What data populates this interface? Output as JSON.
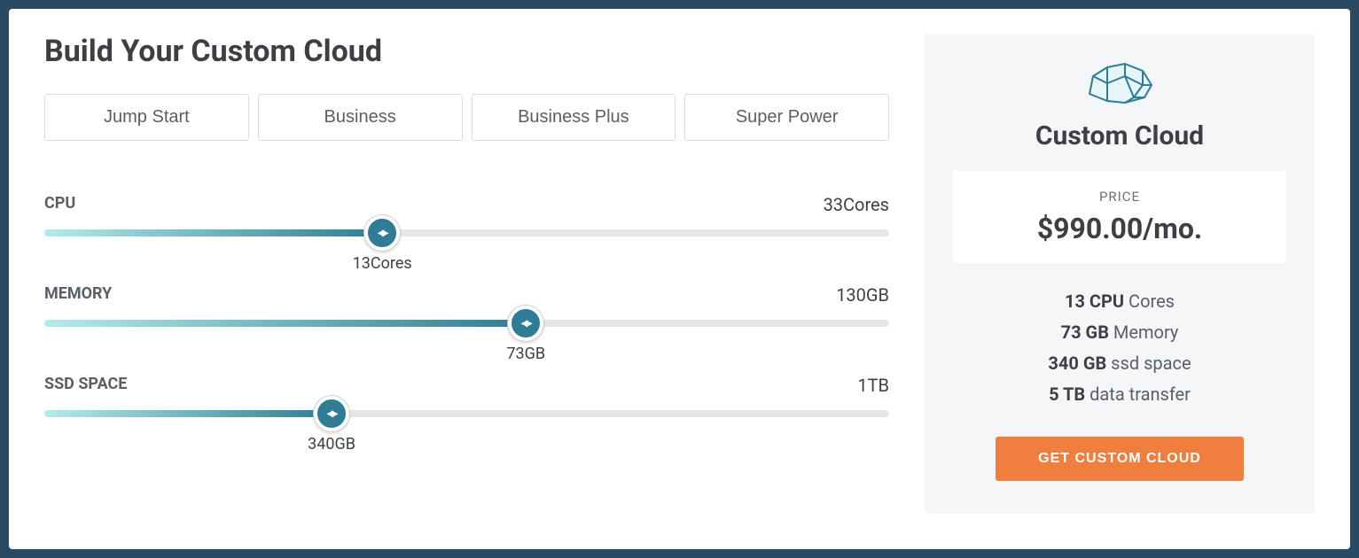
{
  "title": "Build Your Custom Cloud",
  "tabs": [
    "Jump Start",
    "Business",
    "Business Plus",
    "Super Power"
  ],
  "sliders": {
    "cpu": {
      "label": "CPU",
      "max": "33Cores",
      "value": "13Cores",
      "percent": 40
    },
    "memory": {
      "label": "MEMORY",
      "max": "130GB",
      "value": "73GB",
      "percent": 57
    },
    "ssd": {
      "label": "SSD SPACE",
      "max": "1TB",
      "value": "340GB",
      "percent": 34
    }
  },
  "summary": {
    "title": "Custom Cloud",
    "price_label": "PRICE",
    "price": "$990.00/mo.",
    "specs": {
      "cpu_strong": "13 CPU",
      "cpu_rest": " Cores",
      "mem_strong": "73 GB",
      "mem_rest": " Memory",
      "ssd_strong": "340 GB",
      "ssd_rest": " ssd space",
      "data_strong": "5 TB",
      "data_rest": " data transfer"
    },
    "cta": "GET CUSTOM CLOUD"
  }
}
